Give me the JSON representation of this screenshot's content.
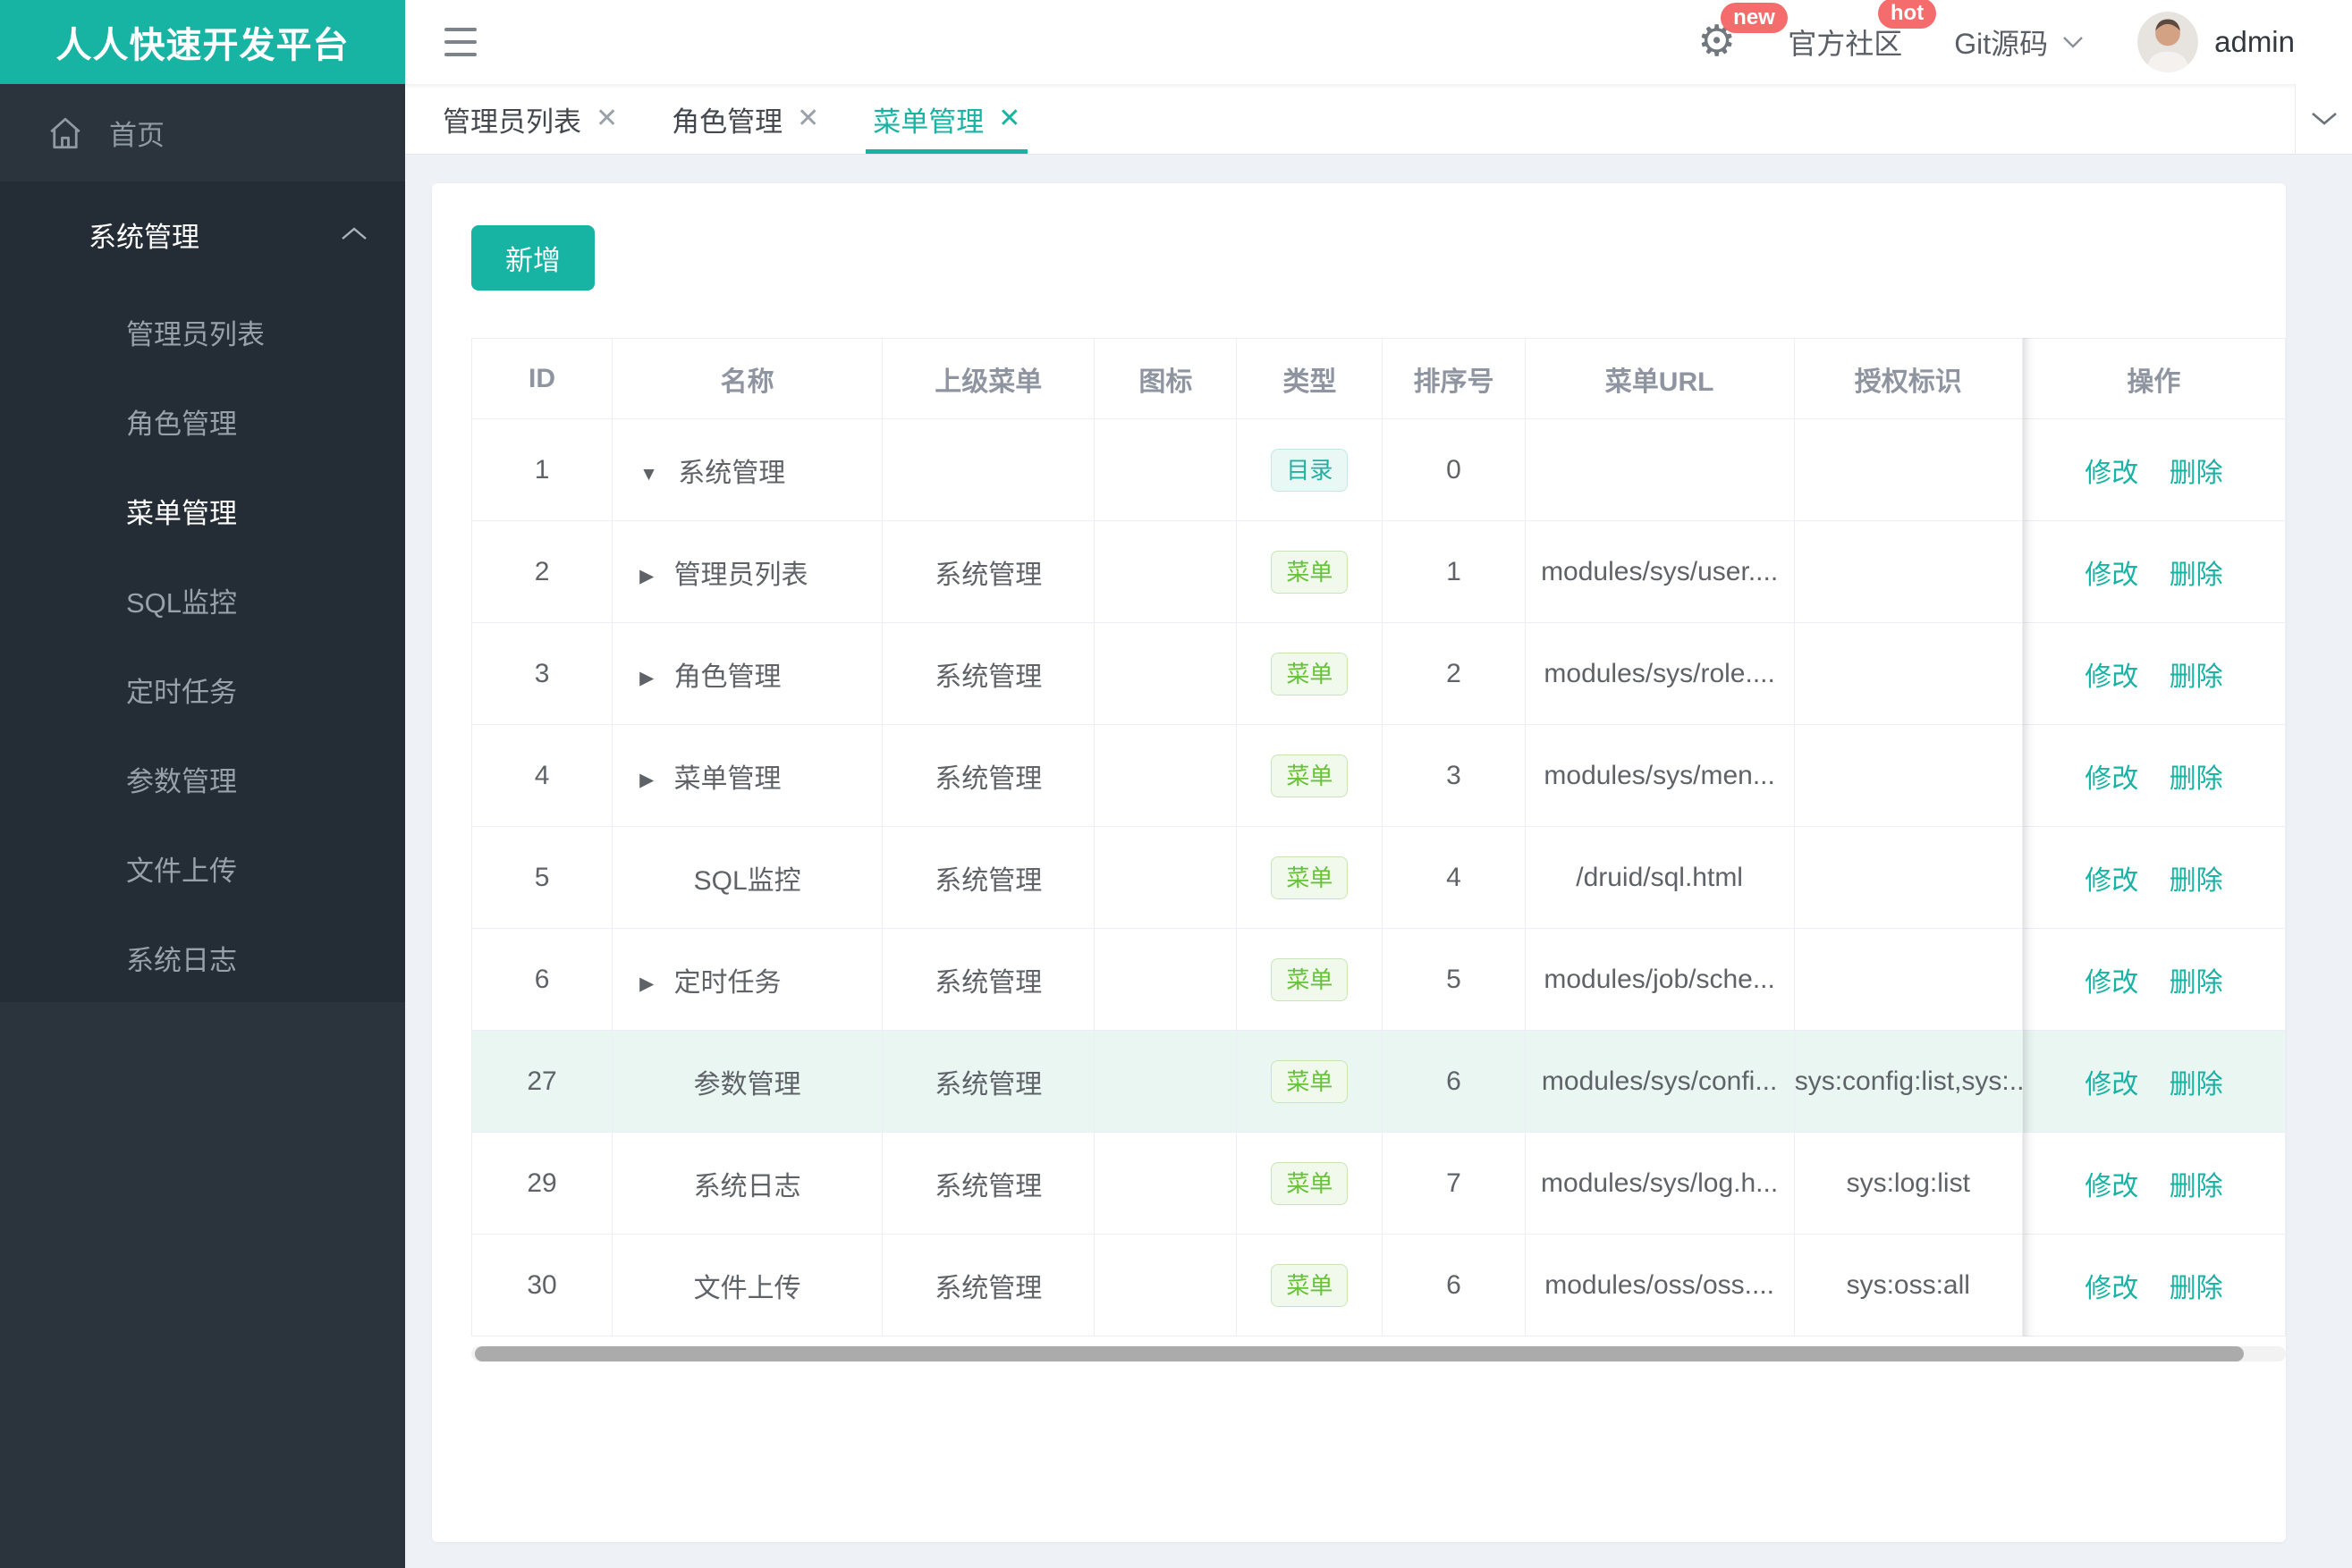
{
  "colors": {
    "accent": "#17b3a3",
    "sidebar_bg": "#2b343d",
    "sidebar_sub_bg": "#242d35",
    "badge_red": "#f56c6c",
    "tag_dir": "#23b0a1",
    "tag_menu": "#67c23a",
    "row_highlight": "#e9f6f2"
  },
  "brand": {
    "title": "人人快速开发平台"
  },
  "sidebar": {
    "home": {
      "label": "首页"
    },
    "group": {
      "label": "系统管理"
    },
    "items": [
      {
        "label": "管理员列表",
        "active": false
      },
      {
        "label": "角色管理",
        "active": false
      },
      {
        "label": "菜单管理",
        "active": true
      },
      {
        "label": "SQL监控",
        "active": false
      },
      {
        "label": "定时任务",
        "active": false
      },
      {
        "label": "参数管理",
        "active": false
      },
      {
        "label": "文件上传",
        "active": false
      },
      {
        "label": "系统日志",
        "active": false
      }
    ]
  },
  "header": {
    "new_badge": "new",
    "hot_badge": "hot",
    "community": "官方社区",
    "git": "Git源码",
    "user": "admin"
  },
  "tabs": [
    {
      "label": "管理员列表",
      "active": false
    },
    {
      "label": "角色管理",
      "active": false
    },
    {
      "label": "菜单管理",
      "active": true
    }
  ],
  "toolbar": {
    "add_label": "新增"
  },
  "table": {
    "columns": [
      "ID",
      "名称",
      "上级菜单",
      "图标",
      "类型",
      "排序号",
      "菜单URL",
      "授权标识",
      "操作"
    ],
    "actions": {
      "edit": "修改",
      "delete": "删除"
    },
    "type_labels": {
      "dir": "目录",
      "menu": "菜单"
    },
    "rows": [
      {
        "id": "1",
        "arrow": "down",
        "name": "系统管理",
        "parent": "",
        "icon": "",
        "type_kind": "dir",
        "order": "0",
        "url": "",
        "perms": "",
        "highlight": false
      },
      {
        "id": "2",
        "arrow": "right",
        "name": "管理员列表",
        "parent": "系统管理",
        "icon": "",
        "type_kind": "menu",
        "order": "1",
        "url": "modules/sys/user....",
        "perms": "",
        "highlight": false
      },
      {
        "id": "3",
        "arrow": "right",
        "name": "角色管理",
        "parent": "系统管理",
        "icon": "",
        "type_kind": "menu",
        "order": "2",
        "url": "modules/sys/role....",
        "perms": "",
        "highlight": false
      },
      {
        "id": "4",
        "arrow": "right",
        "name": "菜单管理",
        "parent": "系统管理",
        "icon": "",
        "type_kind": "menu",
        "order": "3",
        "url": "modules/sys/men...",
        "perms": "",
        "highlight": false
      },
      {
        "id": "5",
        "arrow": "none",
        "name": "SQL监控",
        "parent": "系统管理",
        "icon": "",
        "type_kind": "menu",
        "order": "4",
        "url": "/druid/sql.html",
        "perms": "",
        "highlight": false
      },
      {
        "id": "6",
        "arrow": "right",
        "name": "定时任务",
        "parent": "系统管理",
        "icon": "",
        "type_kind": "menu",
        "order": "5",
        "url": "modules/job/sche...",
        "perms": "",
        "highlight": false
      },
      {
        "id": "27",
        "arrow": "none",
        "name": "参数管理",
        "parent": "系统管理",
        "icon": "",
        "type_kind": "menu",
        "order": "6",
        "url": "modules/sys/confi...",
        "perms": "sys:config:list,sys:...",
        "highlight": true
      },
      {
        "id": "29",
        "arrow": "none",
        "name": "系统日志",
        "parent": "系统管理",
        "icon": "",
        "type_kind": "menu",
        "order": "7",
        "url": "modules/sys/log.h...",
        "perms": "sys:log:list",
        "highlight": false
      },
      {
        "id": "30",
        "arrow": "none",
        "name": "文件上传",
        "parent": "系统管理",
        "icon": "",
        "type_kind": "menu",
        "order": "6",
        "url": "modules/oss/oss....",
        "perms": "sys:oss:all",
        "highlight": false
      }
    ]
  }
}
